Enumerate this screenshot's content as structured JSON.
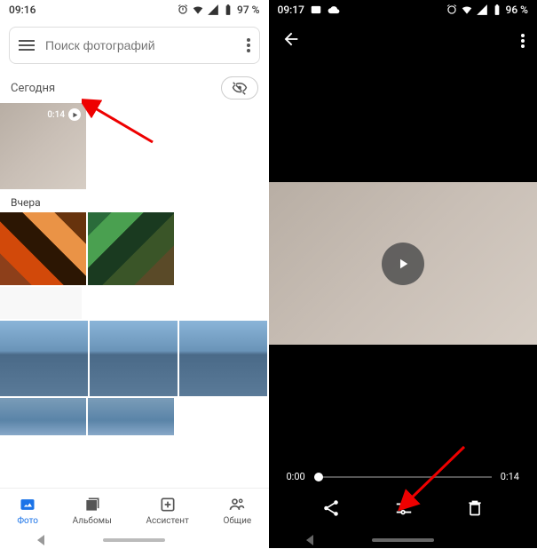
{
  "left": {
    "status": {
      "time": "09:16",
      "battery": "97 %"
    },
    "search": {
      "placeholder": "Поиск фотографий"
    },
    "today": {
      "label": "Сегодня"
    },
    "video_thumb": {
      "duration": "0:14"
    },
    "yesterday": {
      "label": "Вчера"
    },
    "nav": {
      "photos": "Фото",
      "albums": "Альбомы",
      "assistant": "Ассистент",
      "sharing": "Общие"
    }
  },
  "right": {
    "status": {
      "time": "09:17",
      "battery": "96 %"
    },
    "timeline": {
      "current": "0:00",
      "total": "0:14"
    }
  }
}
